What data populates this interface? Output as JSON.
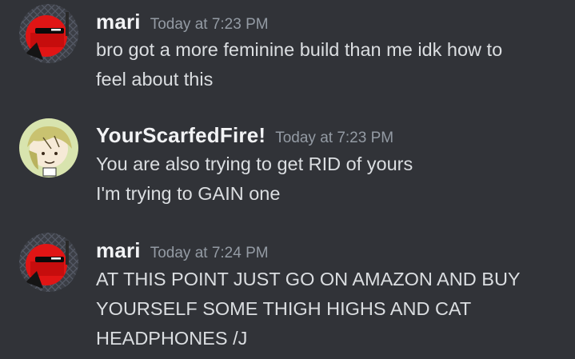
{
  "messages": [
    {
      "author": "mari",
      "timestamp": "Today at 7:23 PM",
      "avatar_icon": "red-helmet-avatar",
      "lines": [
        "bro got a more feminine build than me idk how to",
        "feel about this"
      ]
    },
    {
      "author": "YourScarfedFire!",
      "timestamp": "Today at 7:23 PM",
      "avatar_icon": "blonde-character-avatar",
      "lines": [
        "You are also trying to get RID of yours",
        "I'm trying to GAIN one"
      ]
    },
    {
      "author": "mari",
      "timestamp": "Today at 7:24 PM",
      "avatar_icon": "red-helmet-avatar",
      "lines": [
        "AT THIS POINT JUST GO ON AMAZON AND BUY",
        "YOURSELF SOME THIGH HIGHS AND CAT",
        "HEADPHONES /J"
      ]
    }
  ],
  "colors": {
    "background": "#313338",
    "username": "#f2f3f5",
    "timestamp": "#949ba4",
    "text": "#dbdee1"
  }
}
